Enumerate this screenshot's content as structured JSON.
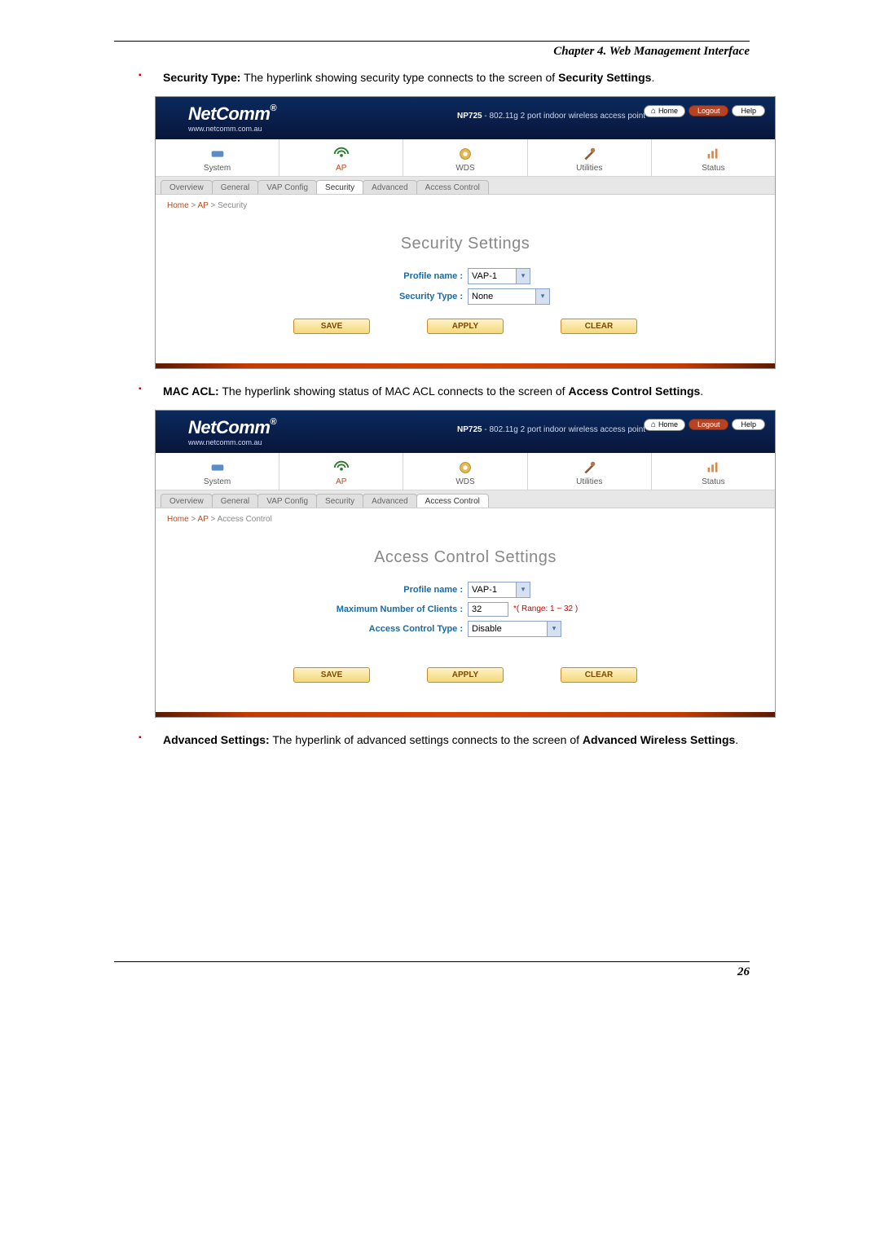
{
  "chapter_header": "Chapter 4. Web Management Interface",
  "page_number": "26",
  "bullets": {
    "security": {
      "label": "Security Type:",
      "text": " The hyperlink showing security type connects to the screen of ",
      "target": "Security Settings",
      "tail": "."
    },
    "macacl": {
      "label": "MAC ACL:",
      "text": " The hyperlink showing status of MAC ACL connects to the screen of ",
      "target": "Access Control Settings",
      "tail": "."
    },
    "advanced": {
      "label": "Advanced Settings:",
      "text": " The hyperlink of advanced settings connects to the screen of ",
      "target": "Advanced Wireless Settings",
      "tail": "."
    }
  },
  "brand": {
    "name": "NetComm",
    "url": "www.netcomm.com.au",
    "reg": "®"
  },
  "product": {
    "model": "NP725",
    "desc": " - 802.11g 2 port indoor wireless access point"
  },
  "topbar": {
    "home": "Home",
    "logout": "Logout",
    "help": "Help"
  },
  "mainnav": {
    "system": "System",
    "ap": "AP",
    "wds": "WDS",
    "utilities": "Utilities",
    "status": "Status"
  },
  "subtabs": {
    "overview": "Overview",
    "general": "General",
    "vap": "VAP Config",
    "security": "Security",
    "advanced": "Advanced",
    "access": "Access Control"
  },
  "crumb": {
    "home": "Home",
    "sep": " > ",
    "ap": "AP",
    "sec": "Security",
    "acc": "Access Control"
  },
  "actions": {
    "save": "SAVE",
    "apply": "APPLY",
    "clear": "CLEAR"
  },
  "panel1": {
    "heading": "Security Settings",
    "profile_label": "Profile name :",
    "profile_value": "VAP-1",
    "sectype_label": "Security Type :",
    "sectype_value": "None"
  },
  "panel2": {
    "heading": "Access Control Settings",
    "profile_label": "Profile name :",
    "profile_value": "VAP-1",
    "maxclients_label": "Maximum Number of Clients :",
    "maxclients_value": "32",
    "maxclients_hint": "*( Range: 1 ~ 32 )",
    "acctype_label": "Access Control Type :",
    "acctype_value": "Disable"
  }
}
